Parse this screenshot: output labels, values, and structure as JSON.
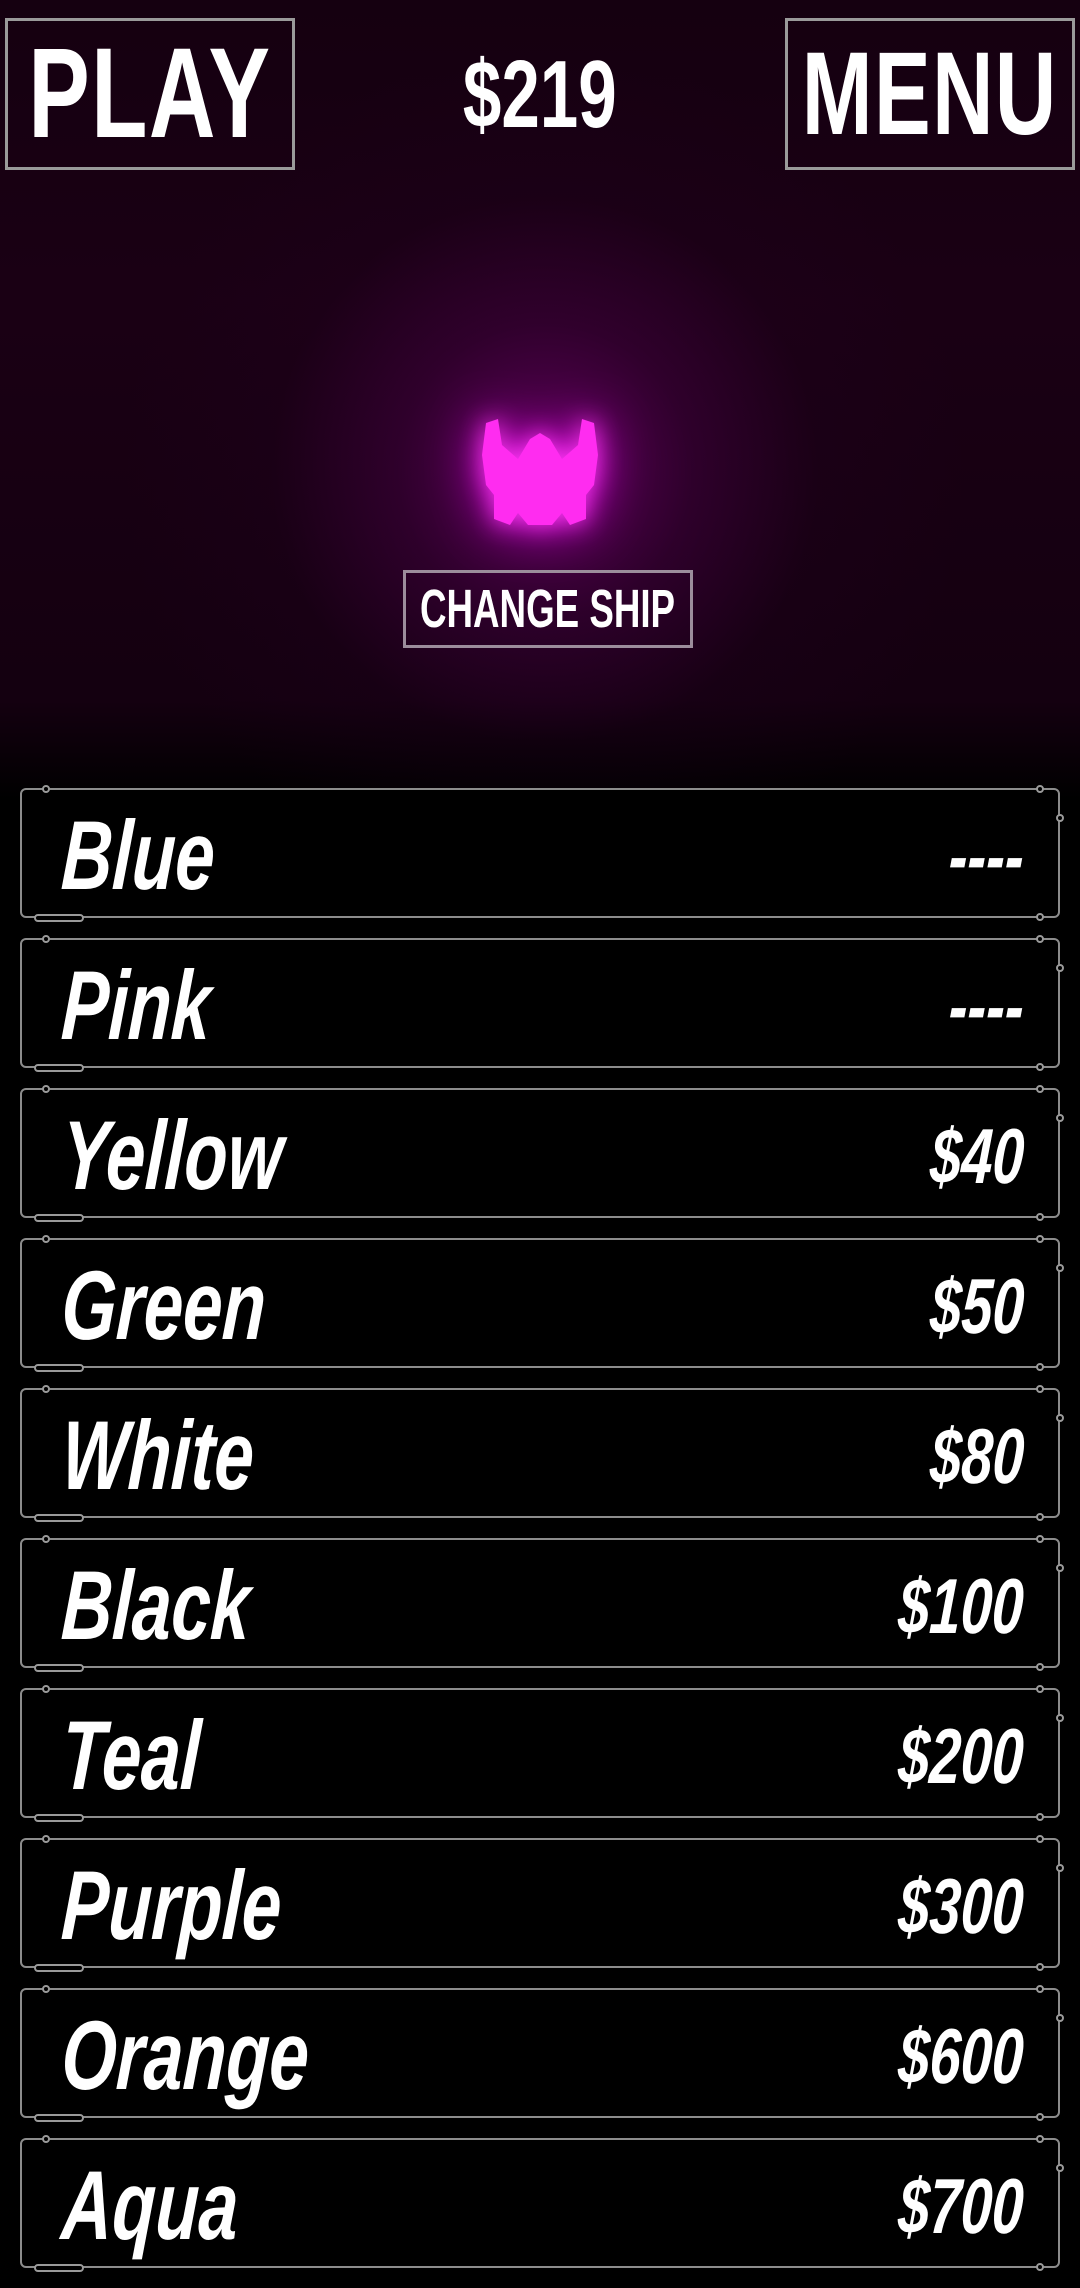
{
  "header": {
    "play_label": "PLAY",
    "money": "$219",
    "menu_label": "MENU"
  },
  "ship": {
    "icon": "ship-icon",
    "color": "#ff2cf0",
    "change_label": "CHANGE SHIP"
  },
  "colors": {
    "background": "#000000",
    "glow": "#a000a8",
    "border": "#8c8c8c",
    "text": "#ffffff"
  },
  "shop": {
    "items": [
      {
        "name": "Blue",
        "price": "----"
      },
      {
        "name": "Pink",
        "price": "----"
      },
      {
        "name": "Yellow",
        "price": "$40"
      },
      {
        "name": "Green",
        "price": "$50"
      },
      {
        "name": "White",
        "price": "$80"
      },
      {
        "name": "Black",
        "price": "$100"
      },
      {
        "name": "Teal",
        "price": "$200"
      },
      {
        "name": "Purple",
        "price": "$300"
      },
      {
        "name": "Orange",
        "price": "$600"
      },
      {
        "name": "Aqua",
        "price": "$700"
      }
    ]
  }
}
